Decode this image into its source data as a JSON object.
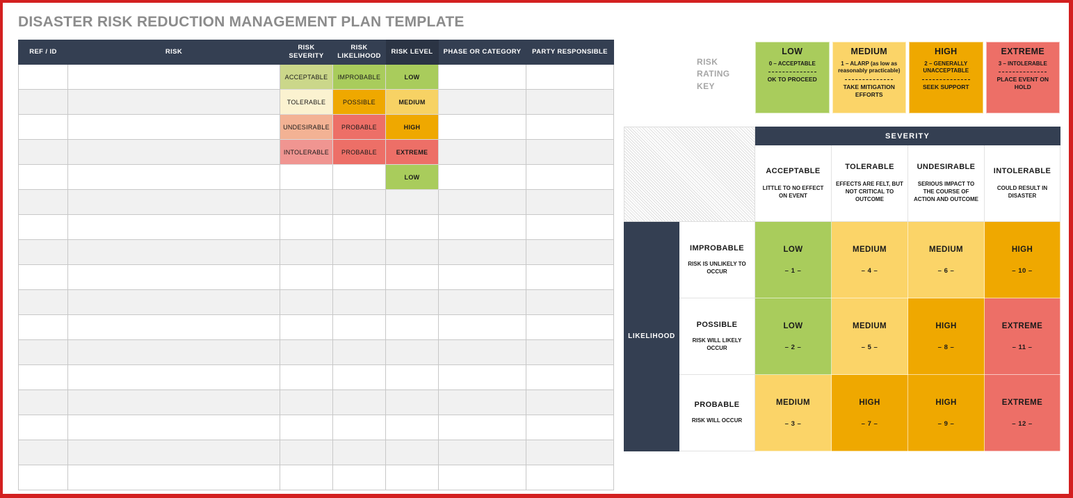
{
  "page": {
    "title": "DISASTER RISK REDUCTION MANAGEMENT PLAN TEMPLATE",
    "border_color": "#d32020",
    "header_color": "#343f52",
    "title_color": "#8c8c8c"
  },
  "plan_table": {
    "columns": [
      {
        "key": "ref_id",
        "label": "REF / ID"
      },
      {
        "key": "risk",
        "label": "RISK"
      },
      {
        "key": "risk_severity",
        "label": "RISK SEVERITY"
      },
      {
        "key": "risk_likelihood",
        "label": "RISK LIKELIHOOD"
      },
      {
        "key": "risk_level",
        "label": "RISK LEVEL"
      },
      {
        "key": "phase_or_category",
        "label": "PHASE  OR CATEGORY"
      },
      {
        "key": "party_responsible",
        "label": "PARTY RESPONSIBLE"
      }
    ],
    "rows": [
      {
        "ref_id": "",
        "risk": "",
        "risk_severity": "ACCEPTABLE",
        "risk_likelihood": "IMPROBABLE",
        "risk_level": "LOW",
        "phase_or_category": "",
        "party_responsible": ""
      },
      {
        "ref_id": "",
        "risk": "",
        "risk_severity": "TOLERABLE",
        "risk_likelihood": "POSSIBLE",
        "risk_level": "MEDIUM",
        "phase_or_category": "",
        "party_responsible": ""
      },
      {
        "ref_id": "",
        "risk": "",
        "risk_severity": "UNDESIRABLE",
        "risk_likelihood": "PROBABLE",
        "risk_level": "HIGH",
        "phase_or_category": "",
        "party_responsible": ""
      },
      {
        "ref_id": "",
        "risk": "",
        "risk_severity": "INTOLERABLE",
        "risk_likelihood": "PROBABLE",
        "risk_level": "EXTREME",
        "phase_or_category": "",
        "party_responsible": ""
      },
      {
        "ref_id": "",
        "risk": "",
        "risk_severity": "",
        "risk_likelihood": "",
        "risk_level": "LOW",
        "phase_or_category": "",
        "party_responsible": ""
      },
      {
        "ref_id": "",
        "risk": "",
        "risk_severity": "",
        "risk_likelihood": "",
        "risk_level": "",
        "phase_or_category": "",
        "party_responsible": ""
      },
      {
        "ref_id": "",
        "risk": "",
        "risk_severity": "",
        "risk_likelihood": "",
        "risk_level": "",
        "phase_or_category": "",
        "party_responsible": ""
      },
      {
        "ref_id": "",
        "risk": "",
        "risk_severity": "",
        "risk_likelihood": "",
        "risk_level": "",
        "phase_or_category": "",
        "party_responsible": ""
      },
      {
        "ref_id": "",
        "risk": "",
        "risk_severity": "",
        "risk_likelihood": "",
        "risk_level": "",
        "phase_or_category": "",
        "party_responsible": ""
      },
      {
        "ref_id": "",
        "risk": "",
        "risk_severity": "",
        "risk_likelihood": "",
        "risk_level": "",
        "phase_or_category": "",
        "party_responsible": ""
      },
      {
        "ref_id": "",
        "risk": "",
        "risk_severity": "",
        "risk_likelihood": "",
        "risk_level": "",
        "phase_or_category": "",
        "party_responsible": ""
      },
      {
        "ref_id": "",
        "risk": "",
        "risk_severity": "",
        "risk_likelihood": "",
        "risk_level": "",
        "phase_or_category": "",
        "party_responsible": ""
      },
      {
        "ref_id": "",
        "risk": "",
        "risk_severity": "",
        "risk_likelihood": "",
        "risk_level": "",
        "phase_or_category": "",
        "party_responsible": ""
      },
      {
        "ref_id": "",
        "risk": "",
        "risk_severity": "",
        "risk_likelihood": "",
        "risk_level": "",
        "phase_or_category": "",
        "party_responsible": ""
      },
      {
        "ref_id": "",
        "risk": "",
        "risk_severity": "",
        "risk_likelihood": "",
        "risk_level": "",
        "phase_or_category": "",
        "party_responsible": ""
      },
      {
        "ref_id": "",
        "risk": "",
        "risk_severity": "",
        "risk_likelihood": "",
        "risk_level": "",
        "phase_or_category": "",
        "party_responsible": ""
      },
      {
        "ref_id": "",
        "risk": "",
        "risk_severity": "",
        "risk_likelihood": "",
        "risk_level": "",
        "phase_or_category": "",
        "party_responsible": ""
      }
    ]
  },
  "risk_rating_key": {
    "label": "RISK RATING KEY",
    "label_lines": [
      "RISK",
      "RATING",
      "KEY"
    ],
    "items": [
      {
        "title": "LOW",
        "score": "0 – ACCEPTABLE",
        "action": "OK TO PROCEED",
        "color": "#a9cc5c"
      },
      {
        "title": "MEDIUM",
        "score": "1 – ALARP (as low as reasonably practicable)",
        "action": "TAKE MITIGATION EFFORTS",
        "color": "#fbd468"
      },
      {
        "title": "HIGH",
        "score": "2 – GENERALLY UNACCEPTABLE",
        "action": "SEEK SUPPORT",
        "color": "#efa800"
      },
      {
        "title": "EXTREME",
        "score": "3 – INTOLERABLE",
        "action": "PLACE EVENT ON HOLD",
        "color": "#ed6f67"
      }
    ]
  },
  "chart_data": {
    "type": "heatmap",
    "title": "Risk Matrix",
    "xlabel": "SEVERITY",
    "ylabel": "LIKELIHOOD",
    "severity_header": "SEVERITY",
    "likelihood_header": "LIKELIHOOD",
    "categories_x": [
      {
        "title": "ACCEPTABLE",
        "desc": "LITTLE TO NO EFFECT ON EVENT"
      },
      {
        "title": "TOLERABLE",
        "desc": "EFFECTS ARE FELT, BUT NOT CRITICAL TO OUTCOME"
      },
      {
        "title": "UNDESIRABLE",
        "desc": "SERIOUS IMPACT TO THE COURSE OF ACTION AND OUTCOME"
      },
      {
        "title": "INTOLERABLE",
        "desc": "COULD RESULT IN DISASTER"
      }
    ],
    "categories_y": [
      {
        "title": "IMPROBABLE",
        "desc": "RISK IS UNLIKELY TO OCCUR"
      },
      {
        "title": "POSSIBLE",
        "desc": "RISK WILL LIKELY OCCUR"
      },
      {
        "title": "PROBABLE",
        "desc": "RISK WILL OCCUR"
      }
    ],
    "cells": [
      [
        {
          "level": "LOW",
          "score": "– 1 –",
          "value": 1,
          "color": "#a9cc5c"
        },
        {
          "level": "MEDIUM",
          "score": "– 4 –",
          "value": 4,
          "color": "#fbd468"
        },
        {
          "level": "MEDIUM",
          "score": "– 6 –",
          "value": 6,
          "color": "#fbd468"
        },
        {
          "level": "HIGH",
          "score": "– 10 –",
          "value": 10,
          "color": "#efa800"
        }
      ],
      [
        {
          "level": "LOW",
          "score": "– 2 –",
          "value": 2,
          "color": "#a9cc5c"
        },
        {
          "level": "MEDIUM",
          "score": "– 5 –",
          "value": 5,
          "color": "#fbd468"
        },
        {
          "level": "HIGH",
          "score": "– 8 –",
          "value": 8,
          "color": "#efa800"
        },
        {
          "level": "EXTREME",
          "score": "– 11 –",
          "value": 11,
          "color": "#ed6f67"
        }
      ],
      [
        {
          "level": "MEDIUM",
          "score": "– 3 –",
          "value": 3,
          "color": "#fbd468"
        },
        {
          "level": "HIGH",
          "score": "– 7 –",
          "value": 7,
          "color": "#efa800"
        },
        {
          "level": "HIGH",
          "score": "– 9 –",
          "value": 9,
          "color": "#efa800"
        },
        {
          "level": "EXTREME",
          "score": "– 12 –",
          "value": 12,
          "color": "#ed6f67"
        }
      ]
    ]
  }
}
